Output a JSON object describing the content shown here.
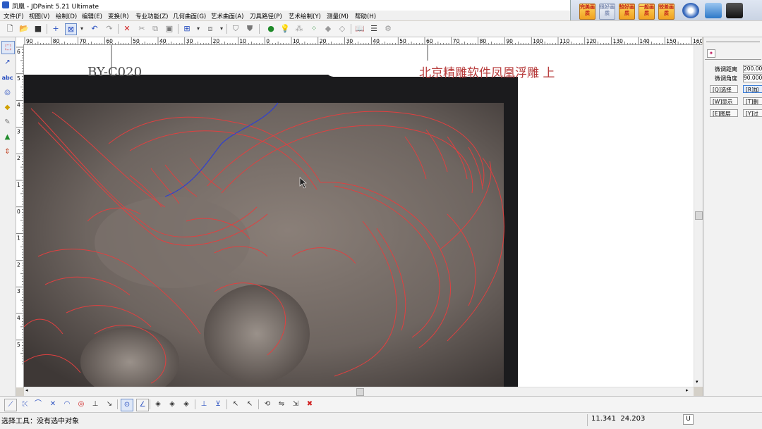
{
  "window": {
    "title": "凤凰 - JDPaint 5.21 Ultimate"
  },
  "menu": [
    "文件(F)",
    "视图(V)",
    "绘制(D)",
    "编辑(E)",
    "变换(R)",
    "专业功能(Z)",
    "几何曲面(G)",
    "艺术曲面(A)",
    "刀具路径(P)",
    "艺术绘制(Y)",
    "测量(M)",
    "帮助(H)"
  ],
  "quality_buttons": [
    "完美画质",
    "很好画质",
    "较好画质",
    "一般画质",
    "较差画质"
  ],
  "hruler_labels": [
    "90",
    "80",
    "70",
    "60",
    "50",
    "40",
    "30",
    "20",
    "10",
    "0",
    "10",
    "20",
    "30",
    "40",
    "50",
    "60",
    "70",
    "80",
    "90",
    "100",
    "110",
    "120",
    "130",
    "140",
    "150",
    "160mm"
  ],
  "vruler_labels": [
    "6",
    "5",
    "4",
    "3",
    "2",
    "1",
    "0",
    "1",
    "2",
    "3",
    "4",
    "5"
  ],
  "canvas": {
    "caption": "北京精雕软件凤凰浮雕 上",
    "photo_text": "BY-C020"
  },
  "right_panel": {
    "rows": [
      {
        "label": "微调距离",
        "value": "200.000"
      },
      {
        "label": "微调角度",
        "value": "90.000"
      }
    ],
    "buttons": [
      "[Q]选择",
      "[R]加",
      "[W]显示",
      "[T]删",
      "[E]图层",
      "[Y]过"
    ]
  },
  "status": {
    "message": "选择工具：没有选中对象",
    "coords": "11.341  24.203",
    "mode": "U"
  },
  "colors": {
    "curve_red": "#e04040",
    "curve_blue": "#3040d0",
    "caption": "#b73b3b"
  }
}
